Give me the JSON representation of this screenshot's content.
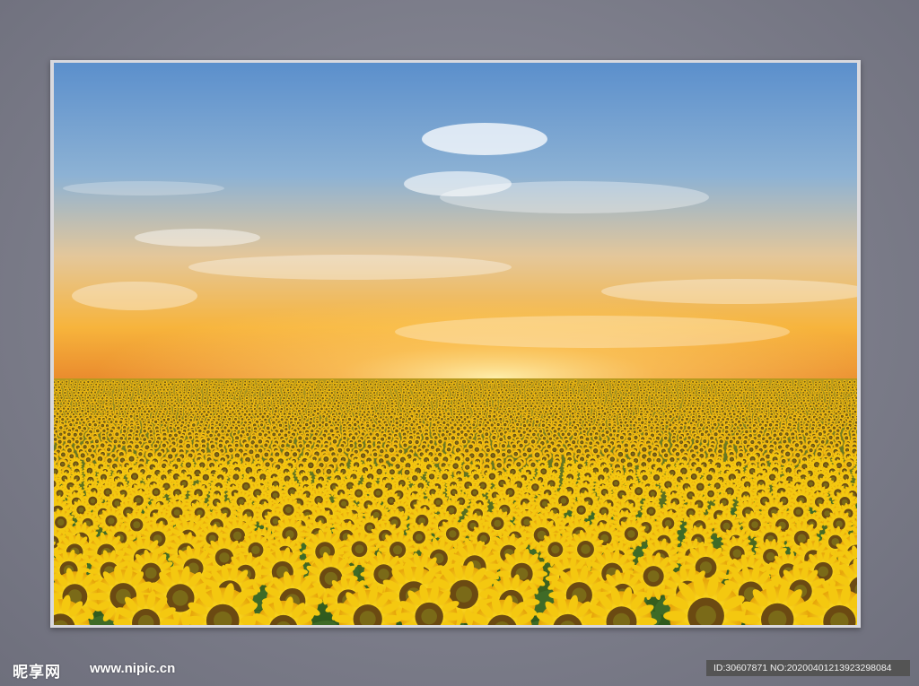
{
  "watermark": {
    "logo_text": "昵享网",
    "site_url": "www.nipic.cn",
    "id_text": "ID:30607871 NO:20200401213923298084"
  },
  "scene": {
    "subject": "sunflower-field-at-sunset",
    "colors": {
      "sky_top": "#5f93cf",
      "sky_horizon": "#f6b640",
      "petal": "#f2c40e",
      "leaf": "#3f6b27"
    }
  }
}
